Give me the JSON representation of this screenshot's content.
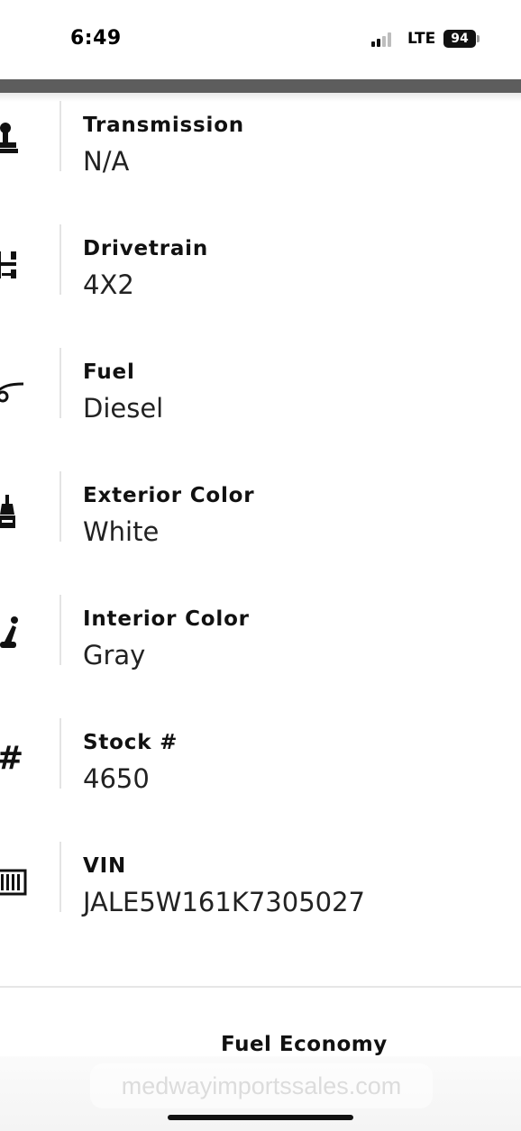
{
  "status_bar": {
    "time": "6:49",
    "network": "LTE",
    "battery": "94"
  },
  "specs": [
    {
      "label": "Transmission",
      "value": "N/A",
      "icon": "gear-shifter-icon"
    },
    {
      "label": "Drivetrain",
      "value": "4X2",
      "icon": "drivetrain-icon"
    },
    {
      "label": "Fuel",
      "value": "Diesel",
      "icon": "fuel-nozzle-icon"
    },
    {
      "label": "Exterior Color",
      "value": "White",
      "icon": "paint-brush-icon"
    },
    {
      "label": "Interior Color",
      "value": "Gray",
      "icon": "car-seat-icon"
    },
    {
      "label": "Stock #",
      "value": "4650",
      "icon": "hash-icon"
    },
    {
      "label": "VIN",
      "value": "JALE5W161K7305027",
      "icon": "barcode-icon"
    }
  ],
  "section_title": "Fuel Economy",
  "browser": {
    "url": "medwayimportssales.com"
  },
  "colors": {
    "header_rule": "#5d5d5d",
    "divider": "#e3e3e3",
    "text": "#111111"
  }
}
